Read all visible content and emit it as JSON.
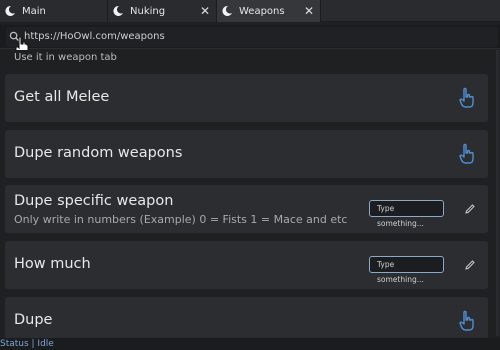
{
  "tabs": [
    {
      "label": "Main",
      "icon": "moon-icon",
      "active": false
    },
    {
      "label": "Nuking",
      "icon": "moon-icon",
      "active": false,
      "close": "✕"
    },
    {
      "label": "Weapons",
      "icon": "moon-icon",
      "active": true,
      "close": "✕"
    }
  ],
  "urlbar": {
    "url": "https://HoOwl.com/weapons",
    "icon": "search-icon"
  },
  "content": {
    "partial_text": "Use it in weapon tab",
    "items": [
      {
        "title": "Get all Melee",
        "action": "hand-pointer-icon"
      },
      {
        "title": "Dupe random weapons",
        "action": "hand-pointer-icon"
      },
      {
        "title": "Dupe specific weapon",
        "description": "Only write in numbers (Example) 0 = Fists 1 = Mace and etc",
        "input_placeholder": "Type something...",
        "action": "pencil-icon"
      },
      {
        "title": "How much",
        "input_placeholder": "Type something...",
        "action": "pencil-icon"
      },
      {
        "title": "Dupe",
        "action": "hand-pointer-icon"
      }
    ]
  },
  "status": {
    "text": "Status | Idle"
  },
  "colors": {
    "background": "#1f2022",
    "card": "#2c2d30",
    "accent": "#7aa6d6",
    "input_border": "#8aa8c8"
  }
}
